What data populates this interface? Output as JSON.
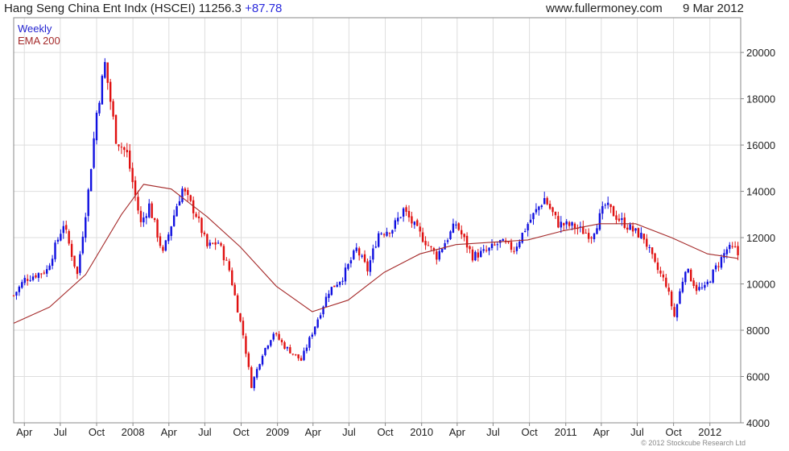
{
  "header": {
    "title": "Hang Seng China Ent Indx (HSCEI) 11256.3",
    "change": "+87.78",
    "site": "www.fullermoney.com",
    "date": "9 Mar 2012"
  },
  "copyright": "© 2012 Stockcube Research Ltd",
  "colors": {
    "up": "#1010e0",
    "down": "#e01010",
    "ema": "#a52a2a",
    "grid": "#dedede"
  },
  "chart_data": {
    "type": "candlestick",
    "series": [
      {
        "name": "Weekly",
        "type": "candlestick"
      },
      {
        "name": "EMA 200",
        "type": "line"
      }
    ],
    "ylim": [
      4000,
      21500
    ],
    "yticks": [
      4000,
      6000,
      8000,
      10000,
      12000,
      14000,
      16000,
      18000,
      20000
    ],
    "xlim": [
      "2007-03-05",
      "2012-03-19"
    ],
    "xticks": [
      {
        "label": "Apr",
        "date": "2007-04-01"
      },
      {
        "label": "Jul",
        "date": "2007-07-01"
      },
      {
        "label": "Oct",
        "date": "2007-10-01"
      },
      {
        "label": "2008",
        "date": "2008-01-01"
      },
      {
        "label": "Apr",
        "date": "2008-04-01"
      },
      {
        "label": "Jul",
        "date": "2008-07-01"
      },
      {
        "label": "Oct",
        "date": "2008-10-01"
      },
      {
        "label": "2009",
        "date": "2009-01-01"
      },
      {
        "label": "Apr",
        "date": "2009-04-01"
      },
      {
        "label": "Jul",
        "date": "2009-07-01"
      },
      {
        "label": "Oct",
        "date": "2009-10-01"
      },
      {
        "label": "2010",
        "date": "2010-01-01"
      },
      {
        "label": "Apr",
        "date": "2010-04-01"
      },
      {
        "label": "Jul",
        "date": "2010-07-01"
      },
      {
        "label": "Oct",
        "date": "2010-10-01"
      },
      {
        "label": "2011",
        "date": "2011-01-01"
      },
      {
        "label": "Apr",
        "date": "2011-04-01"
      },
      {
        "label": "Jul",
        "date": "2011-07-01"
      },
      {
        "label": "Oct",
        "date": "2011-10-01"
      },
      {
        "label": "2012",
        "date": "2012-01-01"
      }
    ],
    "close_anchors": [
      [
        "2007-03-05",
        9500
      ],
      [
        "2007-04-02",
        10200
      ],
      [
        "2007-05-28",
        10600
      ],
      [
        "2007-07-09",
        12600
      ],
      [
        "2007-08-13",
        10400
      ],
      [
        "2007-09-10",
        14000
      ],
      [
        "2007-10-01",
        17400
      ],
      [
        "2007-10-22",
        19500
      ],
      [
        "2007-11-19",
        16300
      ],
      [
        "2007-12-17",
        15600
      ],
      [
        "2008-01-21",
        12600
      ],
      [
        "2008-02-11",
        13400
      ],
      [
        "2008-03-17",
        11300
      ],
      [
        "2008-04-21",
        13400
      ],
      [
        "2008-05-05",
        14100
      ],
      [
        "2008-06-09",
        13000
      ],
      [
        "2008-07-07",
        11600
      ],
      [
        "2008-08-04",
        11800
      ],
      [
        "2008-09-01",
        10600
      ],
      [
        "2008-10-06",
        7800
      ],
      [
        "2008-10-27",
        5600
      ],
      [
        "2008-11-24",
        7000
      ],
      [
        "2008-12-22",
        7900
      ],
      [
        "2009-01-19",
        7300
      ],
      [
        "2009-03-02",
        6700
      ],
      [
        "2009-04-06",
        8200
      ],
      [
        "2009-05-11",
        9700
      ],
      [
        "2009-06-15",
        10300
      ],
      [
        "2009-07-20",
        11500
      ],
      [
        "2009-08-17",
        10600
      ],
      [
        "2009-09-14",
        12200
      ],
      [
        "2009-10-19",
        12400
      ],
      [
        "2009-11-16",
        13200
      ],
      [
        "2009-12-21",
        12300
      ],
      [
        "2010-02-08",
        11200
      ],
      [
        "2010-03-29",
        12600
      ],
      [
        "2010-05-10",
        11200
      ],
      [
        "2010-06-14",
        11400
      ],
      [
        "2010-07-19",
        11800
      ],
      [
        "2010-08-23",
        11500
      ],
      [
        "2010-09-27",
        12600
      ],
      [
        "2010-11-08",
        13700
      ],
      [
        "2010-12-13",
        12600
      ],
      [
        "2011-01-17",
        12500
      ],
      [
        "2011-03-07",
        12100
      ],
      [
        "2011-04-11",
        13400
      ],
      [
        "2011-05-16",
        12800
      ],
      [
        "2011-06-20",
        12300
      ],
      [
        "2011-07-18",
        12000
      ],
      [
        "2011-08-15",
        10800
      ],
      [
        "2011-09-12",
        10000
      ],
      [
        "2011-10-03",
        8600
      ],
      [
        "2011-10-31",
        10700
      ],
      [
        "2011-11-28",
        9800
      ],
      [
        "2011-12-19",
        9800
      ],
      [
        "2012-01-16",
        10700
      ],
      [
        "2012-02-13",
        11500
      ],
      [
        "2012-03-05",
        11500
      ],
      [
        "2012-03-12",
        11256
      ]
    ],
    "ema_anchors": [
      [
        "2007-03-05",
        8300
      ],
      [
        "2007-06-04",
        9000
      ],
      [
        "2007-09-03",
        10400
      ],
      [
        "2007-12-03",
        13000
      ],
      [
        "2008-01-28",
        14300
      ],
      [
        "2008-04-07",
        14100
      ],
      [
        "2008-07-07",
        12900
      ],
      [
        "2008-09-29",
        11600
      ],
      [
        "2008-12-29",
        9900
      ],
      [
        "2009-03-30",
        8800
      ],
      [
        "2009-06-29",
        9300
      ],
      [
        "2009-09-28",
        10500
      ],
      [
        "2009-12-28",
        11300
      ],
      [
        "2010-03-29",
        11700
      ],
      [
        "2010-06-28",
        11800
      ],
      [
        "2010-09-27",
        11900
      ],
      [
        "2010-12-27",
        12300
      ],
      [
        "2011-03-28",
        12600
      ],
      [
        "2011-06-27",
        12600
      ],
      [
        "2011-09-26",
        12000
      ],
      [
        "2011-12-26",
        11300
      ],
      [
        "2012-03-12",
        11100
      ]
    ]
  }
}
